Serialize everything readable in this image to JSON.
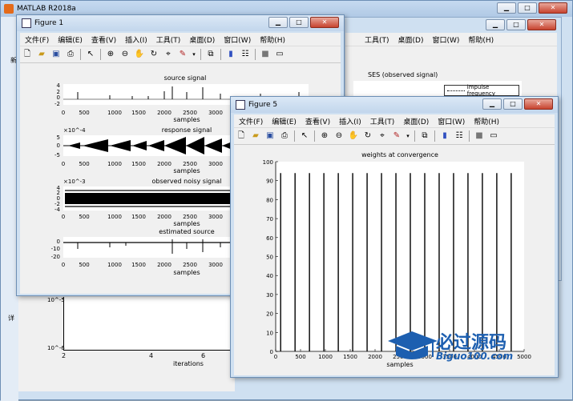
{
  "matlab": {
    "title": "MATLAB R2018a",
    "behind": {
      "fig_menu_tail": [
        "工具(T)",
        "桌面(D)",
        "窗口(W)",
        "帮助(H)"
      ],
      "ses_title": "SES (observed signal)",
      "legend": "impulse frequency",
      "left_labels": [
        "新",
        "详"
      ],
      "bottom_plot": {
        "y_ticks": [
          "10^-5",
          "10^-6"
        ],
        "x_ticks": [
          "2",
          "4",
          "6"
        ],
        "xlabel": "iterations"
      }
    }
  },
  "figure1": {
    "title": "Figure 1",
    "menu": [
      "文件(F)",
      "编辑(E)",
      "查看(V)",
      "插入(I)",
      "工具(T)",
      "桌面(D)",
      "窗口(W)",
      "帮助(H)"
    ],
    "plots": [
      {
        "title": "source signal",
        "y_ticks": [
          "4",
          "2",
          "0",
          "-2"
        ],
        "exponent": ""
      },
      {
        "title": "response signal",
        "y_ticks": [
          "5",
          "0",
          "-5"
        ],
        "exponent": "×10^-4"
      },
      {
        "title": "observed noisy signal",
        "y_ticks": [
          "4",
          "2",
          "0",
          "-2",
          "-4"
        ],
        "exponent": "×10^-3"
      },
      {
        "title": "estimated source",
        "y_ticks": [
          "0",
          "-10",
          "-20"
        ],
        "exponent": ""
      }
    ],
    "x_ticks": [
      "0",
      "500",
      "1000",
      "1500",
      "2000",
      "2500",
      "3000",
      "3"
    ],
    "xlabel": "samples"
  },
  "figure5": {
    "title": "Figure 5",
    "menu": [
      "文件(F)",
      "编辑(E)",
      "查看(V)",
      "插入(I)",
      "工具(T)",
      "桌面(D)",
      "窗口(W)",
      "帮助(H)"
    ]
  },
  "watermark": {
    "text": "必过源码",
    "url": "Biguo100.com"
  },
  "icons": [
    "new-file-icon",
    "open-folder-icon",
    "save-icon",
    "print-icon",
    "pointer-icon",
    "zoom-in-icon",
    "zoom-out-icon",
    "pan-icon",
    "rotate-icon",
    "data-cursor-icon",
    "brush-icon",
    "link-icon",
    "colorbar-icon",
    "legend-icon",
    "hide-plot-tools-icon",
    "show-plot-tools-icon"
  ],
  "chart_data": {
    "type": "line",
    "title": "weights at convergence",
    "xlabel": "samples",
    "ylabel": "",
    "xlim": [
      0,
      5000
    ],
    "ylim": [
      0,
      100
    ],
    "x_ticks": [
      0,
      500,
      1000,
      1500,
      2000,
      2500,
      3000,
      3500,
      4000,
      4500,
      5000
    ],
    "y_ticks": [
      0,
      10,
      20,
      30,
      40,
      50,
      60,
      70,
      80,
      90,
      100
    ],
    "grid": false,
    "series": [
      {
        "x": [
          100,
          390,
          680,
          970,
          1260,
          1550,
          1840,
          2130,
          2420,
          2710,
          3000,
          3290,
          3580,
          3870,
          4160,
          4450,
          4740
        ],
        "y": [
          94,
          94,
          94,
          94,
          94,
          94,
          94,
          94,
          94,
          94,
          94,
          94,
          94,
          94,
          94,
          94,
          94
        ]
      }
    ]
  }
}
